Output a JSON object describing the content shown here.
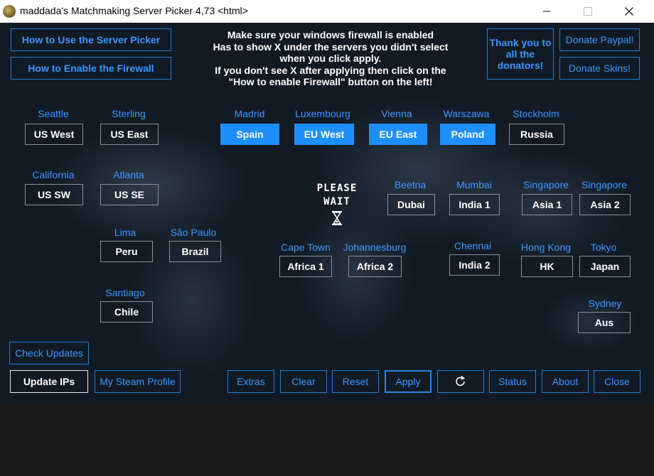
{
  "window": {
    "title": "maddada's Matchmaking Server Picker 4,73 <html>"
  },
  "top_buttons": {
    "how_to_use": "How to Use the Server Picker",
    "how_to_firewall": "How to Enable the Firewall",
    "thank_you": "Thank you to all the donators!",
    "donate_paypal": "Donate Paypal!",
    "donate_skins": "Donate Skins!"
  },
  "notice": {
    "line1": "Make sure your windows firewall is enabled",
    "line2": "Has to show X under the servers you didn't select",
    "line3": "when you click apply.",
    "line4": "If you don't see X after applying then click on the",
    "line5": "\"How to enable Firewall\" button on the left!"
  },
  "status": {
    "line1": "PLEASE",
    "line2": "WAIT"
  },
  "servers": {
    "us_west": {
      "city": "Seattle",
      "label": "US West",
      "selected": false
    },
    "us_east": {
      "city": "Sterling",
      "label": "US East",
      "selected": false
    },
    "spain": {
      "city": "Madrid",
      "label": "Spain",
      "selected": true
    },
    "eu_west": {
      "city": "Luxembourg",
      "label": "EU West",
      "selected": true
    },
    "eu_east": {
      "city": "Vienna",
      "label": "EU East",
      "selected": true
    },
    "poland": {
      "city": "Warszawa",
      "label": "Poland",
      "selected": true
    },
    "russia": {
      "city": "Stockholm",
      "label": "Russia",
      "selected": false
    },
    "us_sw": {
      "city": "California",
      "label": "US SW",
      "selected": false
    },
    "us_se": {
      "city": "Atlanta",
      "label": "US SE",
      "selected": false
    },
    "dubai": {
      "city": "Beetna",
      "label": "Dubai",
      "selected": false
    },
    "india1": {
      "city": "Mumbai",
      "label": "India 1",
      "selected": false
    },
    "asia1": {
      "city": "Singapore",
      "label": "Asia 1",
      "selected": false
    },
    "asia2": {
      "city": "Singapore",
      "label": "Asia 2",
      "selected": false
    },
    "peru": {
      "city": "Lima",
      "label": "Peru",
      "selected": false
    },
    "brazil": {
      "city": "São Paulo",
      "label": "Brazil",
      "selected": false
    },
    "africa1": {
      "city": "Cape Town",
      "label": "Africa 1",
      "selected": false
    },
    "africa2": {
      "city": "Johannesburg",
      "label": "Africa 2",
      "selected": false
    },
    "india2": {
      "city": "Chennai",
      "label": "India 2",
      "selected": false
    },
    "hk": {
      "city": "Hong Kong",
      "label": "HK",
      "selected": false
    },
    "japan": {
      "city": "Tokyo",
      "label": "Japan",
      "selected": false
    },
    "chile": {
      "city": "Santiago",
      "label": "Chile",
      "selected": false
    },
    "aus": {
      "city": "Sydney",
      "label": "Aus",
      "selected": false
    }
  },
  "bottom_buttons": {
    "check_updates": "Check Updates",
    "update_ips": "Update IPs",
    "steam_profile": "My Steam Profile",
    "extras": "Extras",
    "clear": "Clear",
    "reset": "Reset",
    "apply": "Apply",
    "refresh_icon": "refresh-icon",
    "status": "Status",
    "about": "About",
    "close": "Close"
  },
  "colors": {
    "accent": "#3b97ff",
    "selected_fill": "#1e8fff",
    "background": "#121a24"
  }
}
